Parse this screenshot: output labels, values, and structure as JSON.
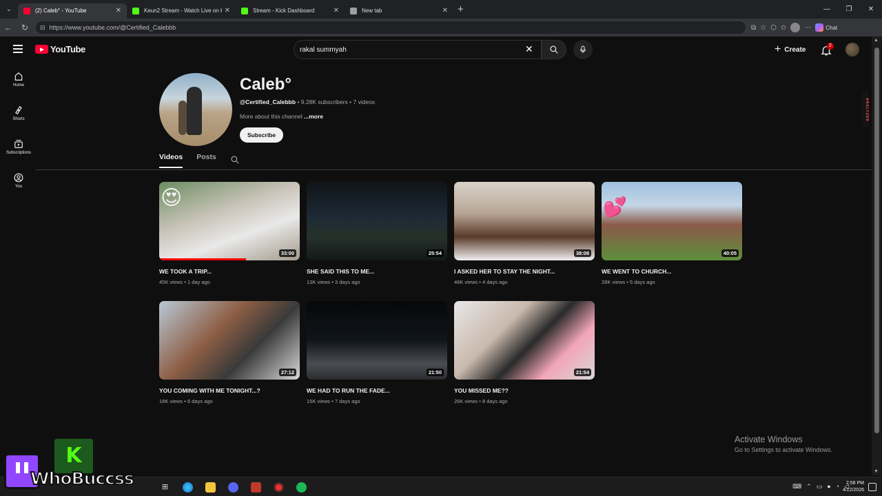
{
  "browser": {
    "tabs": [
      {
        "title": "(2) Caleb° - YouTube",
        "favicon_color": "#ff0033",
        "active": true
      },
      {
        "title": "Keun2 Stream - Watch Live on Kick",
        "favicon_color": "#53fc18",
        "active": false
      },
      {
        "title": "Stream - Kick Dashboard",
        "favicon_color": "#53fc18",
        "active": false
      },
      {
        "title": "New tab",
        "favicon_color": "#9aa0a6",
        "active": false
      }
    ],
    "url": "https://www.youtube.com/@Certified_Calebbb",
    "chat_label": "Chat"
  },
  "header": {
    "logo_text": "YouTube",
    "search_value": "rakal summyah",
    "create_label": "Create",
    "notification_count": "2"
  },
  "guide": {
    "items": [
      {
        "label": "Home",
        "icon": "home-icon"
      },
      {
        "label": "Shorts",
        "icon": "shorts-icon"
      },
      {
        "label": "Subscriptions",
        "icon": "subscriptions-icon"
      },
      {
        "label": "You",
        "icon": "you-icon"
      }
    ]
  },
  "channel": {
    "name": "Caleb°",
    "handle": "@Certified_Calebbb",
    "subscribers": "9.28K subscribers",
    "videos_count": "7 videos",
    "about_text": "More about this channel",
    "more_label": "...more",
    "subscribe_label": "Subscribe"
  },
  "tabs": {
    "videos": "Videos",
    "posts": "Posts"
  },
  "videos": [
    {
      "title": "WE TOOK A TRIP...",
      "views": "45K views",
      "age": "1 day ago",
      "duration": "33:00",
      "watched": true
    },
    {
      "title": "SHE SAID THIS TO ME...",
      "views": "13K views",
      "age": "3 days ago",
      "duration": "25:54",
      "watched": false
    },
    {
      "title": "I ASKED HER TO STAY THE NIGHT...",
      "views": "48K views",
      "age": "4 days ago",
      "duration": "38:08",
      "watched": false
    },
    {
      "title": "WE WENT TO CHURCH...",
      "views": "28K views",
      "age": "5 days ago",
      "duration": "40:05",
      "watched": false
    },
    {
      "title": "YOU COMING WITH ME TONIGHT...?",
      "views": "18K views",
      "age": "6 days ago",
      "duration": "27:12",
      "watched": false
    },
    {
      "title": "WE HAD TO RUN THE FADE...",
      "views": "15K views",
      "age": "7 days ago",
      "duration": "21:50",
      "watched": false
    },
    {
      "title": "YOU MISSED ME??",
      "views": "26K views",
      "age": "8 days ago",
      "duration": "21:54",
      "watched": false
    }
  ],
  "extension": {
    "label": "ANALYZER"
  },
  "activation": {
    "line1": "Activate Windows",
    "line2": "Go to Settings to activate Windows."
  },
  "taskbar": {
    "time": "2:58 PM",
    "date": "4/12/2026"
  },
  "overlay": {
    "text": "WhoBuccss"
  }
}
